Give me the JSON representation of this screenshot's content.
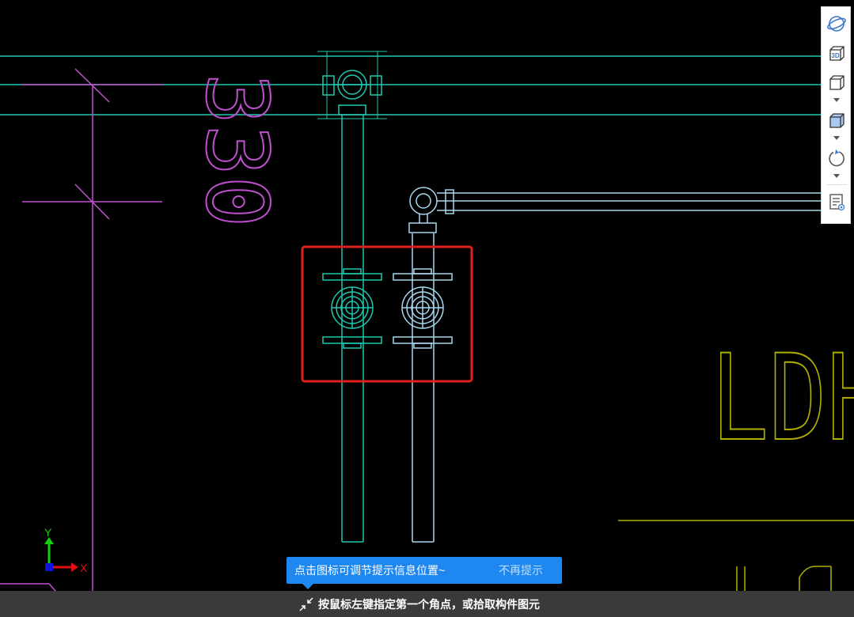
{
  "colors": {
    "background": "#000000",
    "pipe_teal": "#20c8b0",
    "pipe_light_blue": "#a8d8f0",
    "text_magenta": "#c050d0",
    "text_yellow": "#b0b000",
    "selection_red": "#e02020",
    "tip_blue": "#1e88f0",
    "status_bg": "#3a3a3a"
  },
  "drawing": {
    "number_text": "330",
    "label_text_1": "LDH",
    "axis_x_label": "X",
    "axis_y_label": "Y"
  },
  "toolbar": {
    "items": [
      {
        "icon": "orbit-icon"
      },
      {
        "icon": "3d-view-icon",
        "label": "3D"
      },
      {
        "icon": "wireframe-cube-icon"
      },
      {
        "icon": "shaded-cube-icon"
      },
      {
        "icon": "rotate-icon"
      },
      {
        "icon": "property-list-icon"
      }
    ]
  },
  "tip": {
    "message": "点击图标可调节提示信息位置~",
    "dismiss": "不再提示"
  },
  "status": {
    "prompt": "按鼠标左键指定第一个角点，或拾取构件图元"
  }
}
